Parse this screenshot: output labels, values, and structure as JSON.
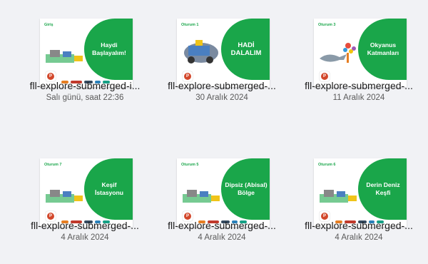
{
  "files": [
    {
      "session": "Giriş",
      "slide_title": "Haydi Başlayalım!",
      "name": "fll-explore-submerged-i...",
      "date": "Salı günü, saat 22:36"
    },
    {
      "session": "Oturum 1",
      "slide_title": "HADİ DALALIM",
      "name": "fll-explore-submerged-...",
      "date": "30 Aralık 2024"
    },
    {
      "session": "Oturum 3",
      "slide_title": "Okyanus Katmanları",
      "name": "fll-explore-submerged-...",
      "date": "11 Aralık 2024"
    },
    {
      "session": "Oturum 7",
      "slide_title": "Keşif İstasyonu",
      "name": "fll-explore-submerged-...",
      "date": "4 Aralık 2024"
    },
    {
      "session": "Oturum 5",
      "slide_title": "Dipsiz (Abisal) Bölge",
      "name": "fll-explore-submerged-...",
      "date": "4 Aralık 2024"
    },
    {
      "session": "Oturum 6",
      "slide_title": "Derin Deniz Keşfi",
      "name": "fll-explore-submerged-...",
      "date": "4 Aralık 2024"
    }
  ],
  "icons": {
    "file_type": "powerpoint-icon"
  },
  "colors": {
    "accent": "#1aa64a",
    "ppt": "#d2472a",
    "background": "#f1f2f5"
  }
}
